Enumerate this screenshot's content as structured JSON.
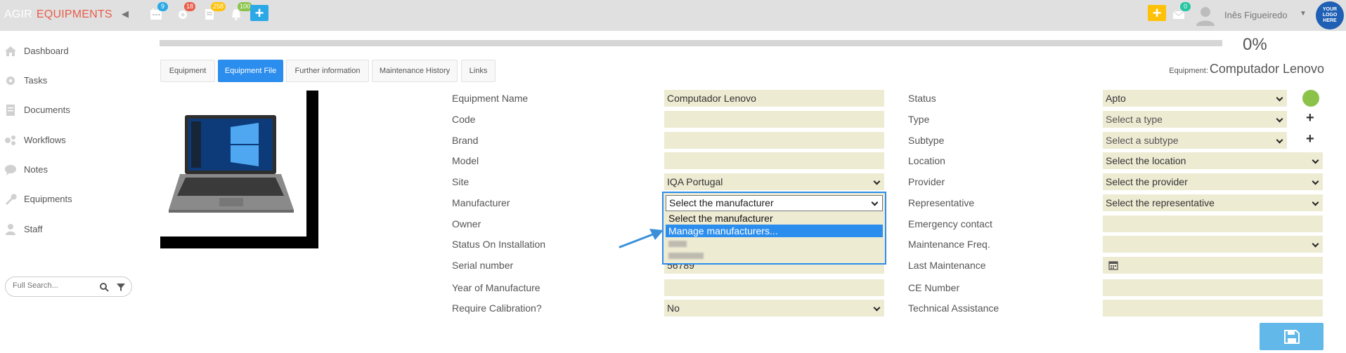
{
  "app": {
    "brand_left": "AGIR",
    "brand_right": "EQUIPMENTS"
  },
  "topbar": {
    "badges": {
      "calendar": "9",
      "gear": "18",
      "doc": "258",
      "bell": "100",
      "mail": "0"
    },
    "user_name": "Inês Figueiredo",
    "logo_text": "YOUR LOGO HERE",
    "colors": {
      "yellow": "#ffc107",
      "blue": "#2ba9e6",
      "red": "#e85c4a",
      "green": "#8bc34a"
    }
  },
  "sidebar": {
    "items": [
      {
        "label": "Dashboard",
        "icon": "home-icon"
      },
      {
        "label": "Tasks",
        "icon": "gear-icon"
      },
      {
        "label": "Documents",
        "icon": "document-icon"
      },
      {
        "label": "Workflows",
        "icon": "workflow-icon"
      },
      {
        "label": "Notes",
        "icon": "chat-icon"
      },
      {
        "label": "Equipments",
        "icon": "wrench-icon"
      },
      {
        "label": "Staff",
        "icon": "user-icon"
      }
    ],
    "search_placeholder": "Full Search..."
  },
  "progress": {
    "value": 0,
    "label": "0%"
  },
  "tabs": [
    "Equipment",
    "Equipment File",
    "Further information",
    "Maintenance History",
    "Links"
  ],
  "active_tab": 1,
  "equipment_caption": {
    "prefix": "Equipment:",
    "name": "Computador Lenovo"
  },
  "form_left": {
    "labels": [
      "Equipment Name",
      "Code",
      "Brand",
      "Model",
      "Site",
      "Manufacturer",
      "Owner",
      "Status On Installation",
      "Serial number",
      "Year of Manufacture",
      "Require Calibration?"
    ],
    "equipment_name": "Computador Lenovo",
    "site": "IQA Portugal",
    "serial_number": "56789",
    "require_calibration": "No"
  },
  "manufacturer_dropdown": {
    "selected": "Select the manufacturer",
    "options": [
      "Select the manufacturer",
      "Manage manufacturers..."
    ],
    "highlighted": "Manage manufacturers..."
  },
  "form_right": {
    "labels": [
      "Status",
      "Type",
      "Subtype",
      "Location",
      "Provider",
      "Representative",
      "Emergency contact",
      "Maintenance Freq.",
      "Last Maintenance",
      "CE Number",
      "Technical Assistance"
    ],
    "status": "Apto",
    "type": "Select a type",
    "subtype": "Select a subtype",
    "location": "Select the location",
    "provider": "Select the provider",
    "representative": "Select the representative"
  }
}
